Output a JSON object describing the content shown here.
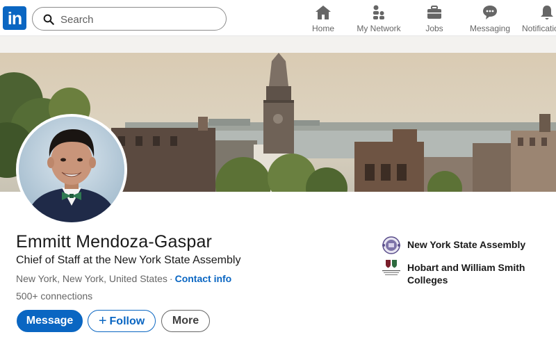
{
  "nav": {
    "logo_text": "in",
    "search": {
      "placeholder": "Search",
      "value": ""
    },
    "items": [
      {
        "label": "Home",
        "icon": "home-icon"
      },
      {
        "label": "My Network",
        "icon": "network-icon"
      },
      {
        "label": "Jobs",
        "icon": "briefcase-icon"
      },
      {
        "label": "Messaging",
        "icon": "messaging-icon"
      },
      {
        "label": "Notifications",
        "icon": "bell-icon"
      }
    ]
  },
  "profile": {
    "name": "Emmitt Mendoza-Gaspar",
    "headline": "Chief of Staff at the New York State Assembly",
    "location": "New York, New York, United States",
    "separator": "·",
    "contact_info_label": "Contact info",
    "connections": "500+ connections",
    "actions": {
      "message_label": "Message",
      "follow_label": "Follow",
      "more_label": "More"
    },
    "organizations": [
      {
        "name": "New York State Assembly",
        "logo": "nys-assembly-seal-logo"
      },
      {
        "name": "Hobart and William Smith Colleges",
        "logo": "hws-colleges-logo"
      }
    ]
  },
  "colors": {
    "brand": "#0a66c2",
    "text": "#191919",
    "muted": "#666666",
    "page_bg": "#f3f2ef"
  }
}
